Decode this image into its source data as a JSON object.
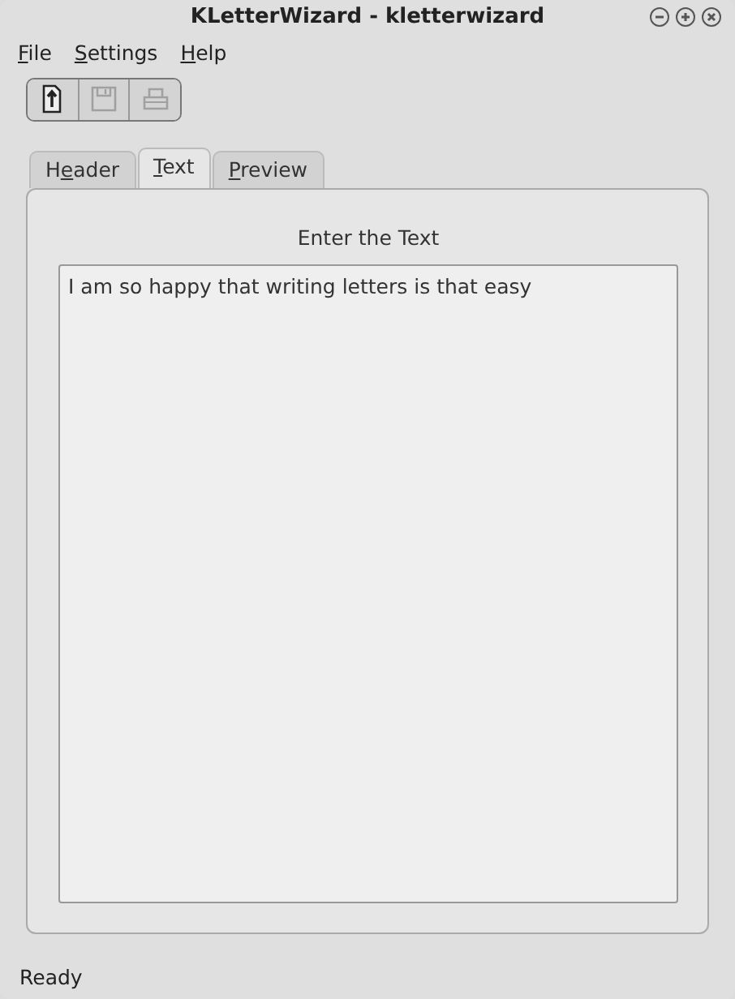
{
  "window": {
    "title": "KLetterWizard - kletterwizard"
  },
  "menu": [
    {
      "access_key": "F",
      "rest": "ile"
    },
    {
      "access_key": "S",
      "rest": "ettings"
    },
    {
      "access_key": "H",
      "rest": "elp"
    }
  ],
  "toolbar": [
    {
      "kind": "open",
      "disabled": false
    },
    {
      "kind": "save",
      "disabled": true
    },
    {
      "kind": "print",
      "disabled": true
    }
  ],
  "tabs": [
    {
      "lead": "H",
      "access_key": "e",
      "rest": "ader",
      "selected": false
    },
    {
      "access_key": "T",
      "rest": "ext",
      "selected": true
    },
    {
      "access_key": "P",
      "rest": "review",
      "selected": false
    }
  ],
  "panel": {
    "heading": "Enter the Text",
    "text": "I am so happy that writing letters is that easy"
  },
  "status_bar": "Ready"
}
